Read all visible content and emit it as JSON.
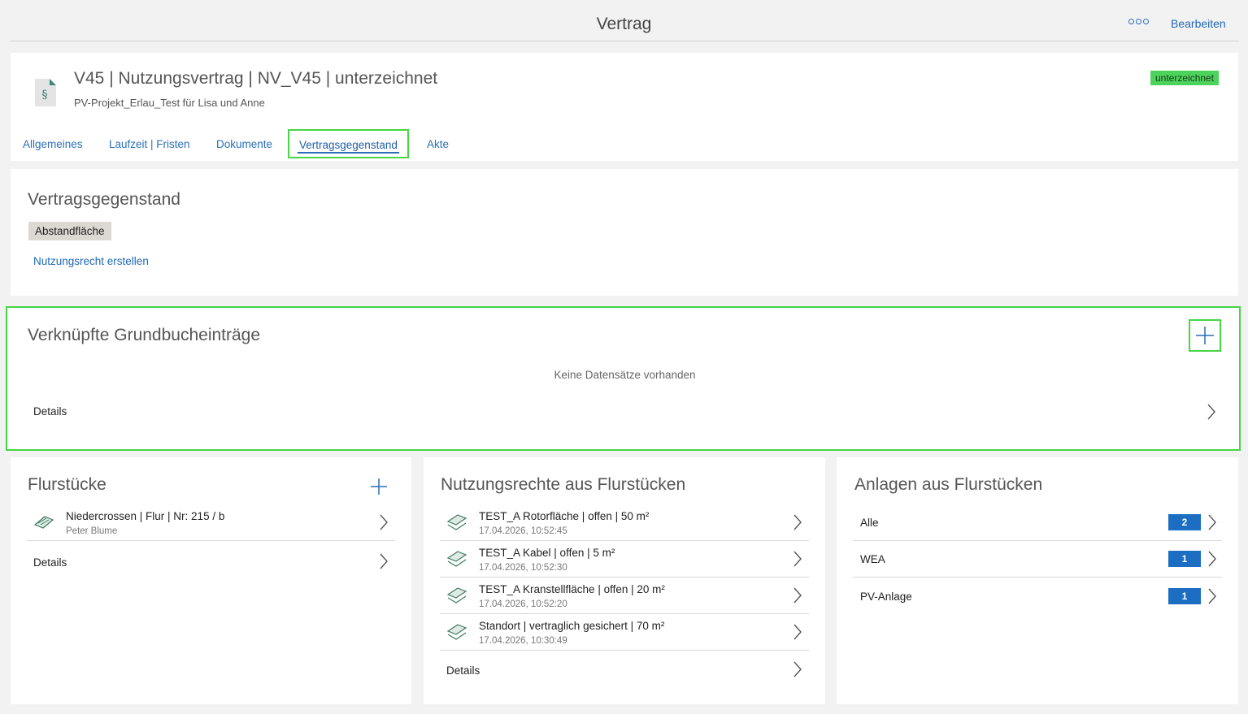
{
  "topbar": {
    "title": "Vertrag",
    "edit_label": "Bearbeiten"
  },
  "header": {
    "title": "V45 | Nutzungsvertrag | NV_V45 | unterzeichnet",
    "subtitle": "PV-Projekt_Erlau_Test für Lisa und Anne",
    "status_badge": "unterzeichnet",
    "status_color": "#4cd35b",
    "doc_icon_glyph": "§",
    "tabs": [
      {
        "label": "Allgemeines"
      },
      {
        "label": "Laufzeit | Fristen"
      },
      {
        "label": "Dokumente"
      },
      {
        "label": "Vertragsgegenstand",
        "active": true
      },
      {
        "label": "Akte"
      }
    ]
  },
  "vertragsgegenstand": {
    "title": "Vertragsgegenstand",
    "chip": "Abstandfläche",
    "create_link": "Nutzungsrecht erstellen"
  },
  "grundbuch": {
    "title": "Verknüpfte Grundbucheinträge",
    "empty_text": "Keine Datensätze vorhanden",
    "details_label": "Details"
  },
  "flurstuecke": {
    "title": "Flurstücke",
    "items": [
      {
        "title": "Niedercrossen | Flur | Nr: 215 / b",
        "subtitle": "Peter Blume"
      }
    ],
    "details_label": "Details"
  },
  "nutzungsrechte": {
    "title": "Nutzungsrechte aus Flurstücken",
    "items": [
      {
        "title": "TEST_A Rotorfläche | offen | 50 m²",
        "subtitle": "17.04.2026, 10:52:45"
      },
      {
        "title": "TEST_A Kabel | offen | 5 m²",
        "subtitle": "17.04.2026, 10:52:30"
      },
      {
        "title": "TEST_A Kranstellfläche | offen | 20 m²",
        "subtitle": "17.04.2026, 10:52:20"
      },
      {
        "title": "Standort | vertraglich gesichert | 70 m²",
        "subtitle": "17.04.2026, 10:30:49"
      }
    ],
    "details_label": "Details"
  },
  "anlagen": {
    "title": "Anlagen aus Flurstücken",
    "items": [
      {
        "label": "Alle",
        "count": "2"
      },
      {
        "label": "WEA",
        "count": "1"
      },
      {
        "label": "PV-Anlage",
        "count": "1"
      }
    ]
  },
  "colors": {
    "accent": "#1f68b5",
    "highlight": "#46d646",
    "count_badge": "#1b6ec2"
  }
}
